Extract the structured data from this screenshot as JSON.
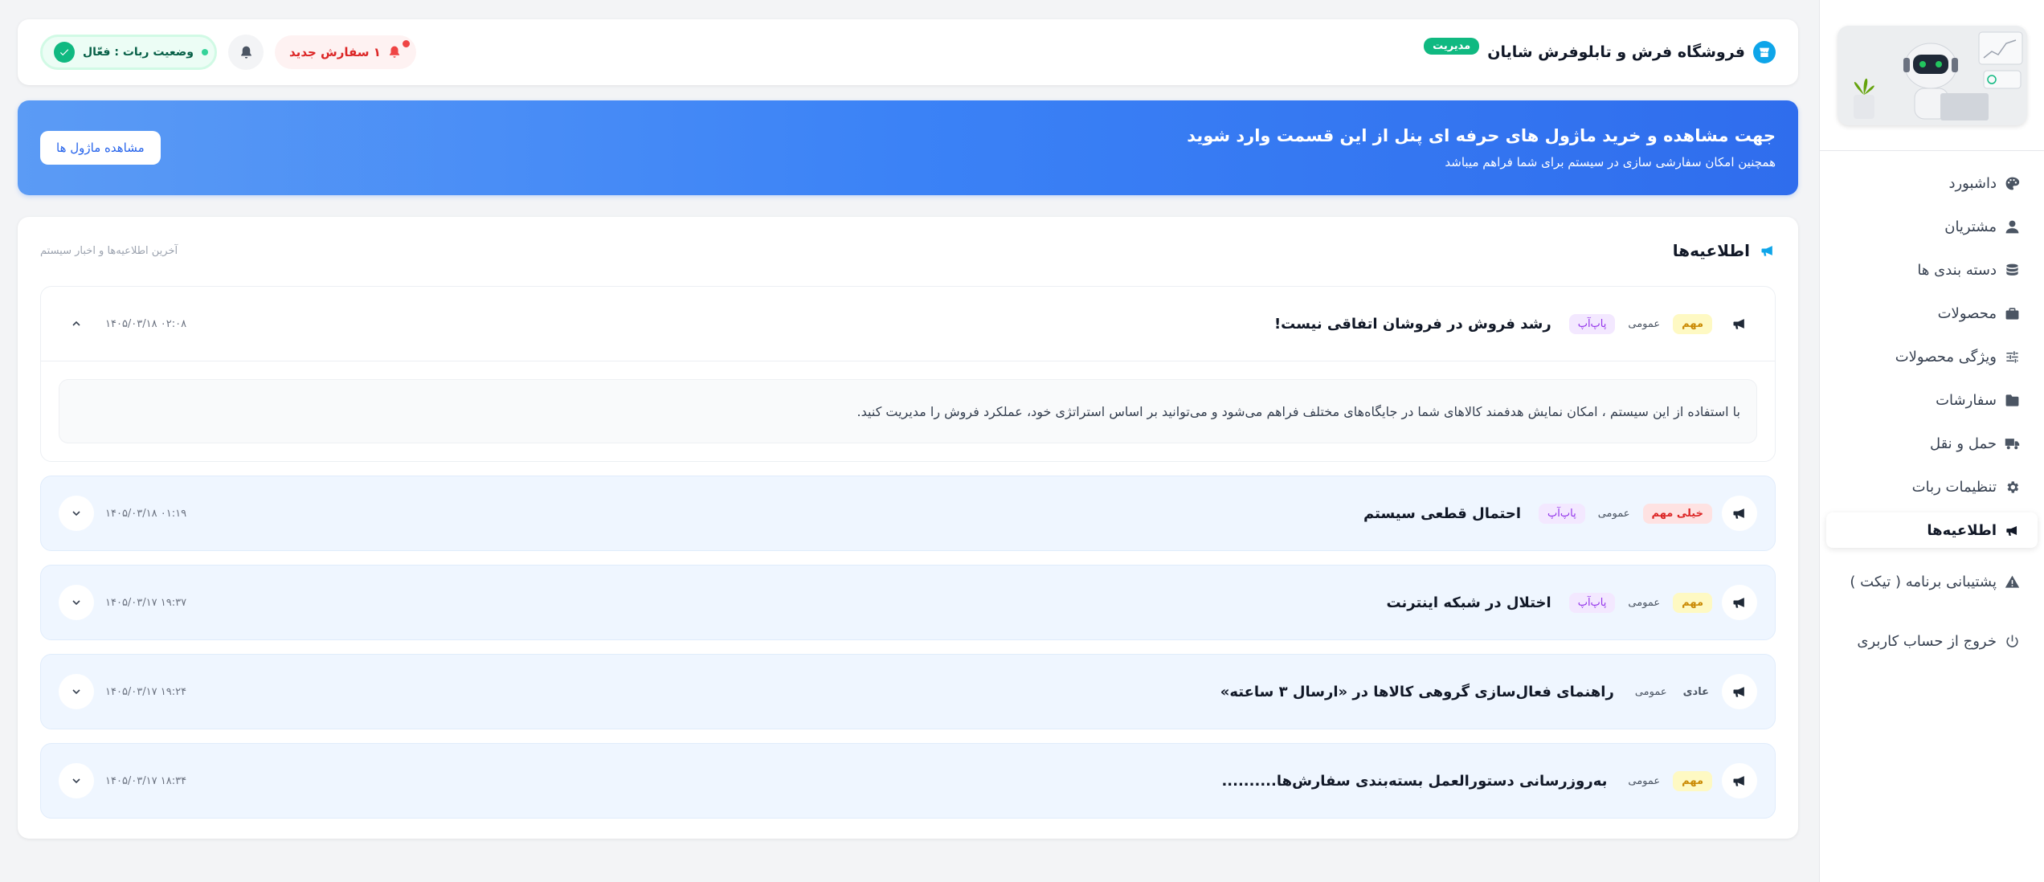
{
  "header": {
    "store_name": "فروشگاه فرش و تابلوفرش شایان",
    "admin_badge": "مدیریت",
    "new_orders": "۱ سفارش جدید",
    "robot_status": "وضعیت ربات : فعّال"
  },
  "promo": {
    "title": "جهت مشاهده و خرید ماژول های حرفه ای پنل از این قسمت وارد شوید",
    "subtitle": "همچنین امکان سفارشی سازی در سیستم برای شما فراهم میباشد",
    "button": "مشاهده ماژول ها"
  },
  "sidebar": {
    "items": [
      {
        "label": "داشبورد",
        "icon": "palette-icon"
      },
      {
        "label": "مشتریان",
        "icon": "user-icon"
      },
      {
        "label": "دسته بندی ها",
        "icon": "database-icon"
      },
      {
        "label": "محصولات",
        "icon": "briefcase-icon"
      },
      {
        "label": "ویژگی محصولات",
        "icon": "sliders-icon"
      },
      {
        "label": "سفارشات",
        "icon": "folder-icon"
      },
      {
        "label": "حمل و نقل",
        "icon": "truck-icon"
      },
      {
        "label": "تنظیمات ربات",
        "icon": "gear-icon"
      },
      {
        "label": "اطلاعیه‌ها",
        "icon": "megaphone-icon"
      },
      {
        "label": "پشتیبانی برنامه ( تیکت )",
        "icon": "warning-icon"
      },
      {
        "label": "خروج از حساب کاربری",
        "icon": "power-icon"
      }
    ],
    "active_index": 8
  },
  "panel": {
    "title": "اطلاعیه‌ها",
    "subtitle": "آخرین اطلاعیه‌ها و اخبار سیستم"
  },
  "announcements": [
    {
      "title": "رشد فروش در فروشان اتفاقی نیست!",
      "priority": "مهم",
      "category": "عمومی",
      "type": "پاپ‌آپ",
      "date": "۱۴۰۵/۰۳/۱۸ ۰۲:۰۸",
      "body": "با استفاده از این سیستم ، امکان نمایش هدفمند کالاهای شما در جایگاه‌های مختلف فراهم می‌شود و می‌توانید بر اساس استراتژی خود، عملکرد فروش را مدیریت کنید.",
      "expanded": true
    },
    {
      "title": "احتمال قطعی سیستم",
      "priority": "خیلی مهم",
      "category": "عمومی",
      "type": "پاپ‌آپ",
      "date": "۱۴۰۵/۰۳/۱۸ ۰۱:۱۹",
      "expanded": false
    },
    {
      "title": "اختلال در شبکه اینترنت",
      "priority": "مهم",
      "category": "عمومی",
      "type": "پاپ‌آپ",
      "date": "۱۴۰۵/۰۳/۱۷ ۱۹:۳۷",
      "expanded": false
    },
    {
      "title": "راهنمای فعال‌سازی گروهی کالاها در «ارسال ۳ ساعته»",
      "priority": "عادی",
      "category": "عمومی",
      "date": "۱۴۰۵/۰۳/۱۷ ۱۹:۲۴",
      "expanded": false
    },
    {
      "title": "به‌روزرسانی دستورالعمل بسته‌بندی سفارش‌ها..........",
      "priority": "مهم",
      "category": "عمومی",
      "date": "۱۴۰۵/۰۳/۱۷ ۱۸:۳۴",
      "expanded": false
    }
  ],
  "colors": {
    "accent": "#3b82f6",
    "success": "#10b981",
    "danger": "#ef4444",
    "important": "#ca8a04",
    "popup": "#9333ea"
  }
}
